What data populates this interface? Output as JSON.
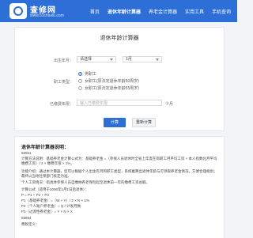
{
  "header": {
    "logo_title": "查修网",
    "logo_sub": "www.51chaxiu.com",
    "nav": [
      "首页",
      "退休年龄计算器",
      "养老金计算器",
      "实用工具",
      "手机查询"
    ]
  },
  "form": {
    "title": "退休年龄计算器",
    "birth_label": "出生年月：",
    "year_value": "请选择",
    "month_value": "1月",
    "worker_type_label": "职工类型：",
    "options": [
      "男职工",
      "女职工(原法定退休年龄50周岁)",
      "女职工(原法定退休年龄55周岁)"
    ],
    "selected_option": 0,
    "contribution_label": "已缴费年限：",
    "contribution_placeholder": "输入已缴费年限",
    "contribution_unit": "个月",
    "calc_button": "计算",
    "reset_button": "重新计算"
  },
  "info": {
    "title": "退休年龄计算器说明：",
    "lines": [
      "56551",
      "计算方法说明：基础养老金计算公式为：基础养老金 =（参保人员退休时全省上年度在岗职工月平均工资 + 本人指数化月平均缴费工资）/ 2 × 缴费年限 × 1%。",
      "功能介绍：通过本计算器，您可以根据个人出生年月和职工类型，系统推算出退休年龄与可领取养老金情况，方便合理规划；最终以当地社保部门核定为准。",
      "个人工资情况：指具体参保人员自缴纳养老保险起至退休前一年的缴费工资总额。",
      "计算公式（适用于2006年1月1日后退休）：",
      "P = P1 + P2 + P3",
      "P1（基础养老金）=（W + Y）/ 2 × N × 1%",
      "P2（个人账户养老金）= Q / 计发月数",
      "P3（过渡性养老金）= Y × N × X",
      "55654",
      "费税定义："
    ]
  }
}
